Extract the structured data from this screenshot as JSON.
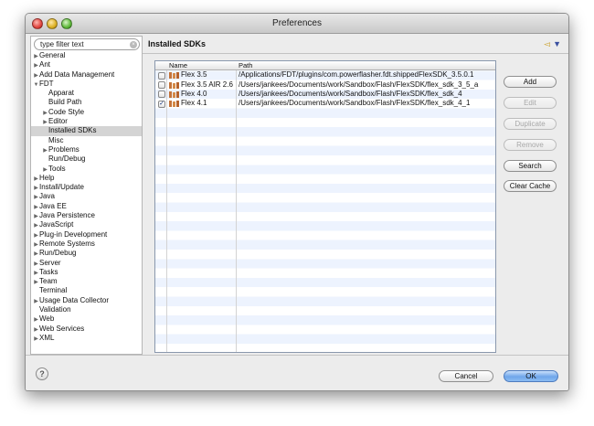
{
  "window": {
    "title": "Preferences"
  },
  "sidebar": {
    "filter_placeholder": "type filter text",
    "items": [
      {
        "label": "General",
        "expander": "▶",
        "level": 0
      },
      {
        "label": "Ant",
        "expander": "▶",
        "level": 0
      },
      {
        "label": "Add Data Management",
        "expander": "▶",
        "level": 0
      },
      {
        "label": "FDT",
        "expander": "▼",
        "level": 0
      },
      {
        "label": "Apparat",
        "expander": "",
        "level": 1
      },
      {
        "label": "Build Path",
        "expander": "",
        "level": 1
      },
      {
        "label": "Code Style",
        "expander": "▶",
        "level": 1
      },
      {
        "label": "Editor",
        "expander": "▶",
        "level": 1
      },
      {
        "label": "Installed SDKs",
        "expander": "",
        "level": 1,
        "selected": true
      },
      {
        "label": "Misc",
        "expander": "",
        "level": 1
      },
      {
        "label": "Problems",
        "expander": "▶",
        "level": 1
      },
      {
        "label": "Run/Debug",
        "expander": "",
        "level": 1
      },
      {
        "label": "Tools",
        "expander": "▶",
        "level": 1
      },
      {
        "label": "Help",
        "expander": "▶",
        "level": 0
      },
      {
        "label": "Install/Update",
        "expander": "▶",
        "level": 0
      },
      {
        "label": "Java",
        "expander": "▶",
        "level": 0
      },
      {
        "label": "Java EE",
        "expander": "▶",
        "level": 0
      },
      {
        "label": "Java Persistence",
        "expander": "▶",
        "level": 0
      },
      {
        "label": "JavaScript",
        "expander": "▶",
        "level": 0
      },
      {
        "label": "Plug-in Development",
        "expander": "▶",
        "level": 0
      },
      {
        "label": "Remote Systems",
        "expander": "▶",
        "level": 0
      },
      {
        "label": "Run/Debug",
        "expander": "▶",
        "level": 0
      },
      {
        "label": "Server",
        "expander": "▶",
        "level": 0
      },
      {
        "label": "Tasks",
        "expander": "▶",
        "level": 0
      },
      {
        "label": "Team",
        "expander": "▶",
        "level": 0
      },
      {
        "label": "Terminal",
        "expander": "",
        "level": 0
      },
      {
        "label": "Usage Data Collector",
        "expander": "▶",
        "level": 0
      },
      {
        "label": "Validation",
        "expander": "",
        "level": 0
      },
      {
        "label": "Web",
        "expander": "▶",
        "level": 0
      },
      {
        "label": "Web Services",
        "expander": "▶",
        "level": 0
      },
      {
        "label": "XML",
        "expander": "▶",
        "level": 0
      }
    ]
  },
  "main": {
    "title": "Installed SDKs",
    "nav": {
      "back_icon": "◅",
      "menu_icon": "▼"
    },
    "table": {
      "columns": [
        "Name",
        "Path"
      ],
      "rows": [
        {
          "checked": false,
          "name": "Flex 3.5",
          "path": "/Applications/FDT/plugins/com.powerflasher.fdt.shippedFlexSDK_3.5.0.1"
        },
        {
          "checked": false,
          "name": "Flex 3.5 AIR 2.6",
          "path": "/Users/jankees/Documents/work/Sandbox/Flash/FlexSDK/flex_sdk_3_5_a"
        },
        {
          "checked": false,
          "name": "Flex 4.0",
          "path": "/Users/jankees/Documents/work/Sandbox/Flash/FlexSDK/flex_sdk_4"
        },
        {
          "checked": true,
          "name": "Flex 4.1",
          "path": "/Users/jankees/Documents/work/Sandbox/Flash/FlexSDK/flex_sdk_4_1"
        }
      ]
    },
    "buttons": [
      {
        "label": "Add",
        "enabled": true
      },
      {
        "label": "Edit",
        "enabled": false
      },
      {
        "label": "Duplicate",
        "enabled": false
      },
      {
        "label": "Remove",
        "enabled": false
      },
      {
        "label": "Search",
        "enabled": true
      },
      {
        "label": "Clear Cache",
        "enabled": true
      }
    ]
  },
  "footer": {
    "help_icon": "?",
    "cancel_label": "Cancel",
    "ok_label": "OK"
  },
  "colors": {
    "accent": "#6fa6ea",
    "row_stripe": "#edf3fe",
    "selected_item": "#d4d4d4"
  }
}
